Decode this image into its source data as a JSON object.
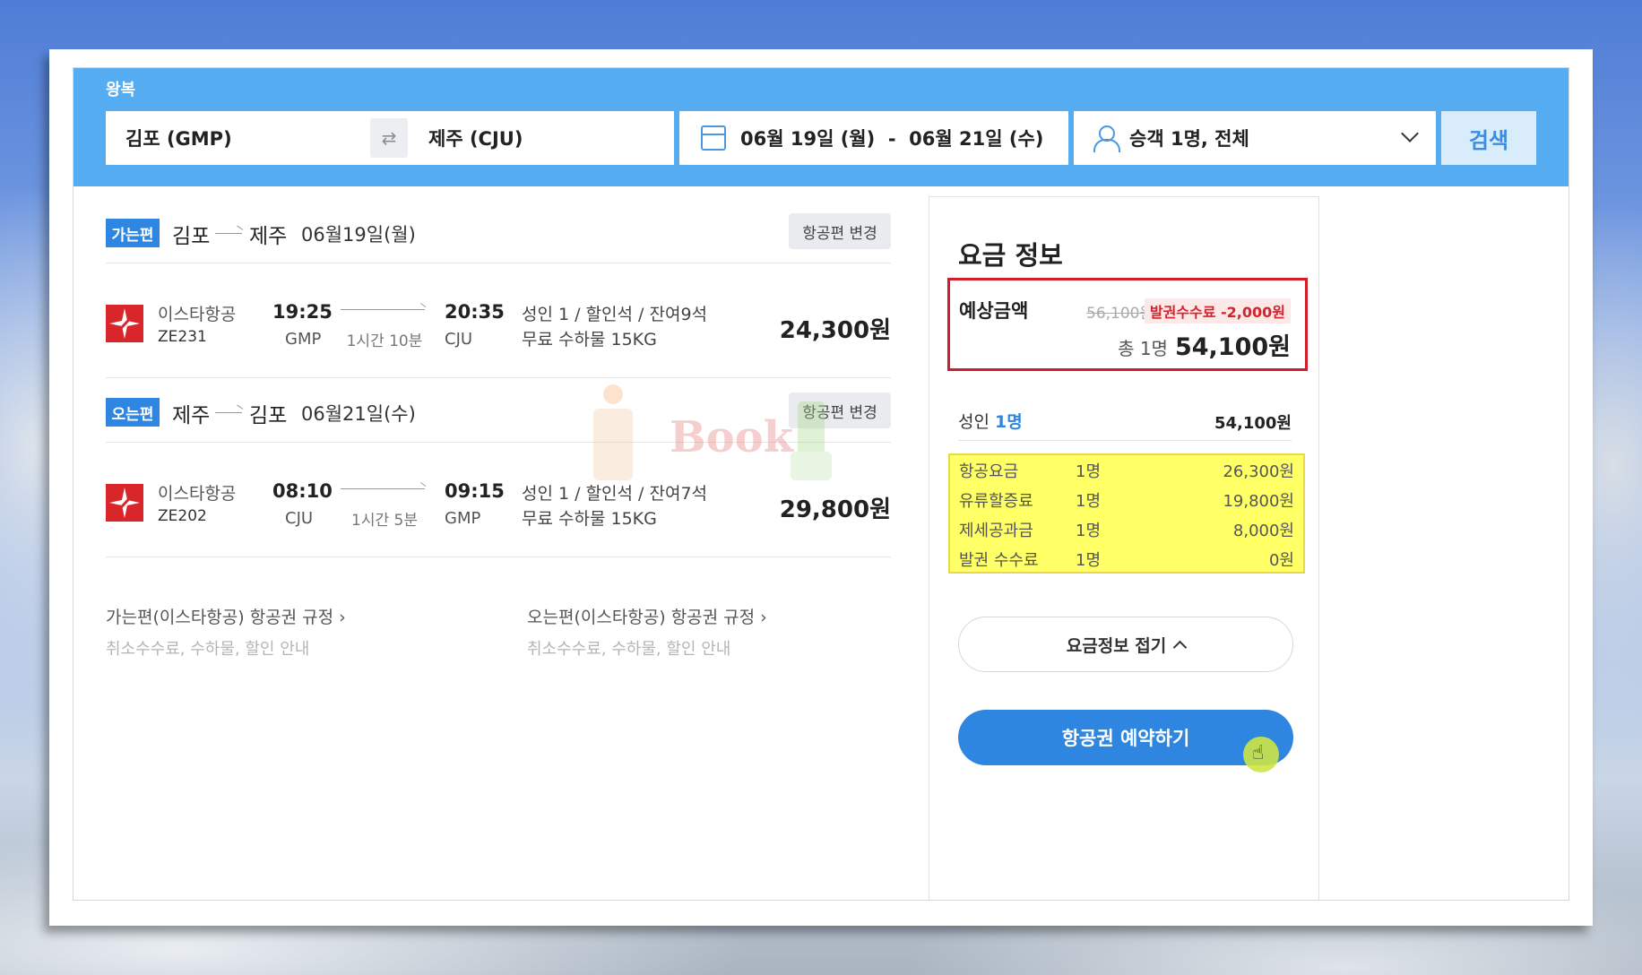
{
  "search": {
    "trip_type": "왕복",
    "from": "김포 (GMP)",
    "to": "제주 (CJU)",
    "swap_icon": "⇄",
    "dates": "06월 19일 (월)  -  06월 21일 (수)",
    "passengers": "승객 1명, 전체",
    "search_label": "검색"
  },
  "segments": [
    {
      "badge": "가는편",
      "from": "김포",
      "to": "제주",
      "date": "06월19일(월)",
      "change_label": "항공편 변경",
      "flight": {
        "airline": "이스타항공",
        "number": "ZE231",
        "dep_time": "19:25",
        "dep_code": "GMP",
        "duration": "1시간 10분",
        "arr_time": "20:35",
        "arr_code": "CJU",
        "seat": "성인 1 / 할인석 / 잔여9석",
        "baggage": "무료 수하물 15KG",
        "price": "24,300원"
      }
    },
    {
      "badge": "오는편",
      "from": "제주",
      "to": "김포",
      "date": "06월21일(수)",
      "change_label": "항공편 변경",
      "flight": {
        "airline": "이스타항공",
        "number": "ZE202",
        "dep_time": "08:10",
        "dep_code": "CJU",
        "duration": "1시간 5분",
        "arr_time": "09:15",
        "arr_code": "GMP",
        "seat": "성인 1 / 할인석 / 잔여7석",
        "baggage": "무료 수하물 15KG",
        "price": "29,800원"
      }
    }
  ],
  "rules": [
    {
      "title": "가는편(이스타항공) 항공권 규정  ›",
      "sub": "취소수수료, 수하물, 할인 안내"
    },
    {
      "title": "오는편(이스타항공) 항공권 규정  ›",
      "sub": "취소수수료, 수하물, 할인 안내"
    }
  ],
  "fare": {
    "title": "요금 정보",
    "estimate_label": "예상금액",
    "old_price": "56,100원",
    "fee_badge": "발권수수료 -2,000원",
    "total_prefix": "총 1명",
    "total": "54,100원",
    "adult_label": "성인",
    "adult_count": "1명",
    "adult_amount": "54,100원",
    "breakdown": [
      {
        "name": "항공요금",
        "count": "1명",
        "amount": "26,300원"
      },
      {
        "name": "유류할증료",
        "count": "1명",
        "amount": "19,800원"
      },
      {
        "name": "제세공과금",
        "count": "1명",
        "amount": "8,000원"
      },
      {
        "name": "발권 수수료",
        "count": "1명",
        "amount": "0원"
      }
    ],
    "fold_label": "요금정보 접기",
    "book_label": "항공권 예약하기"
  },
  "watermark": "Book",
  "colors": {
    "accent": "#2f86e0",
    "header": "#55acf0",
    "highlight": "#ffff66",
    "alert": "#d11f2a"
  }
}
